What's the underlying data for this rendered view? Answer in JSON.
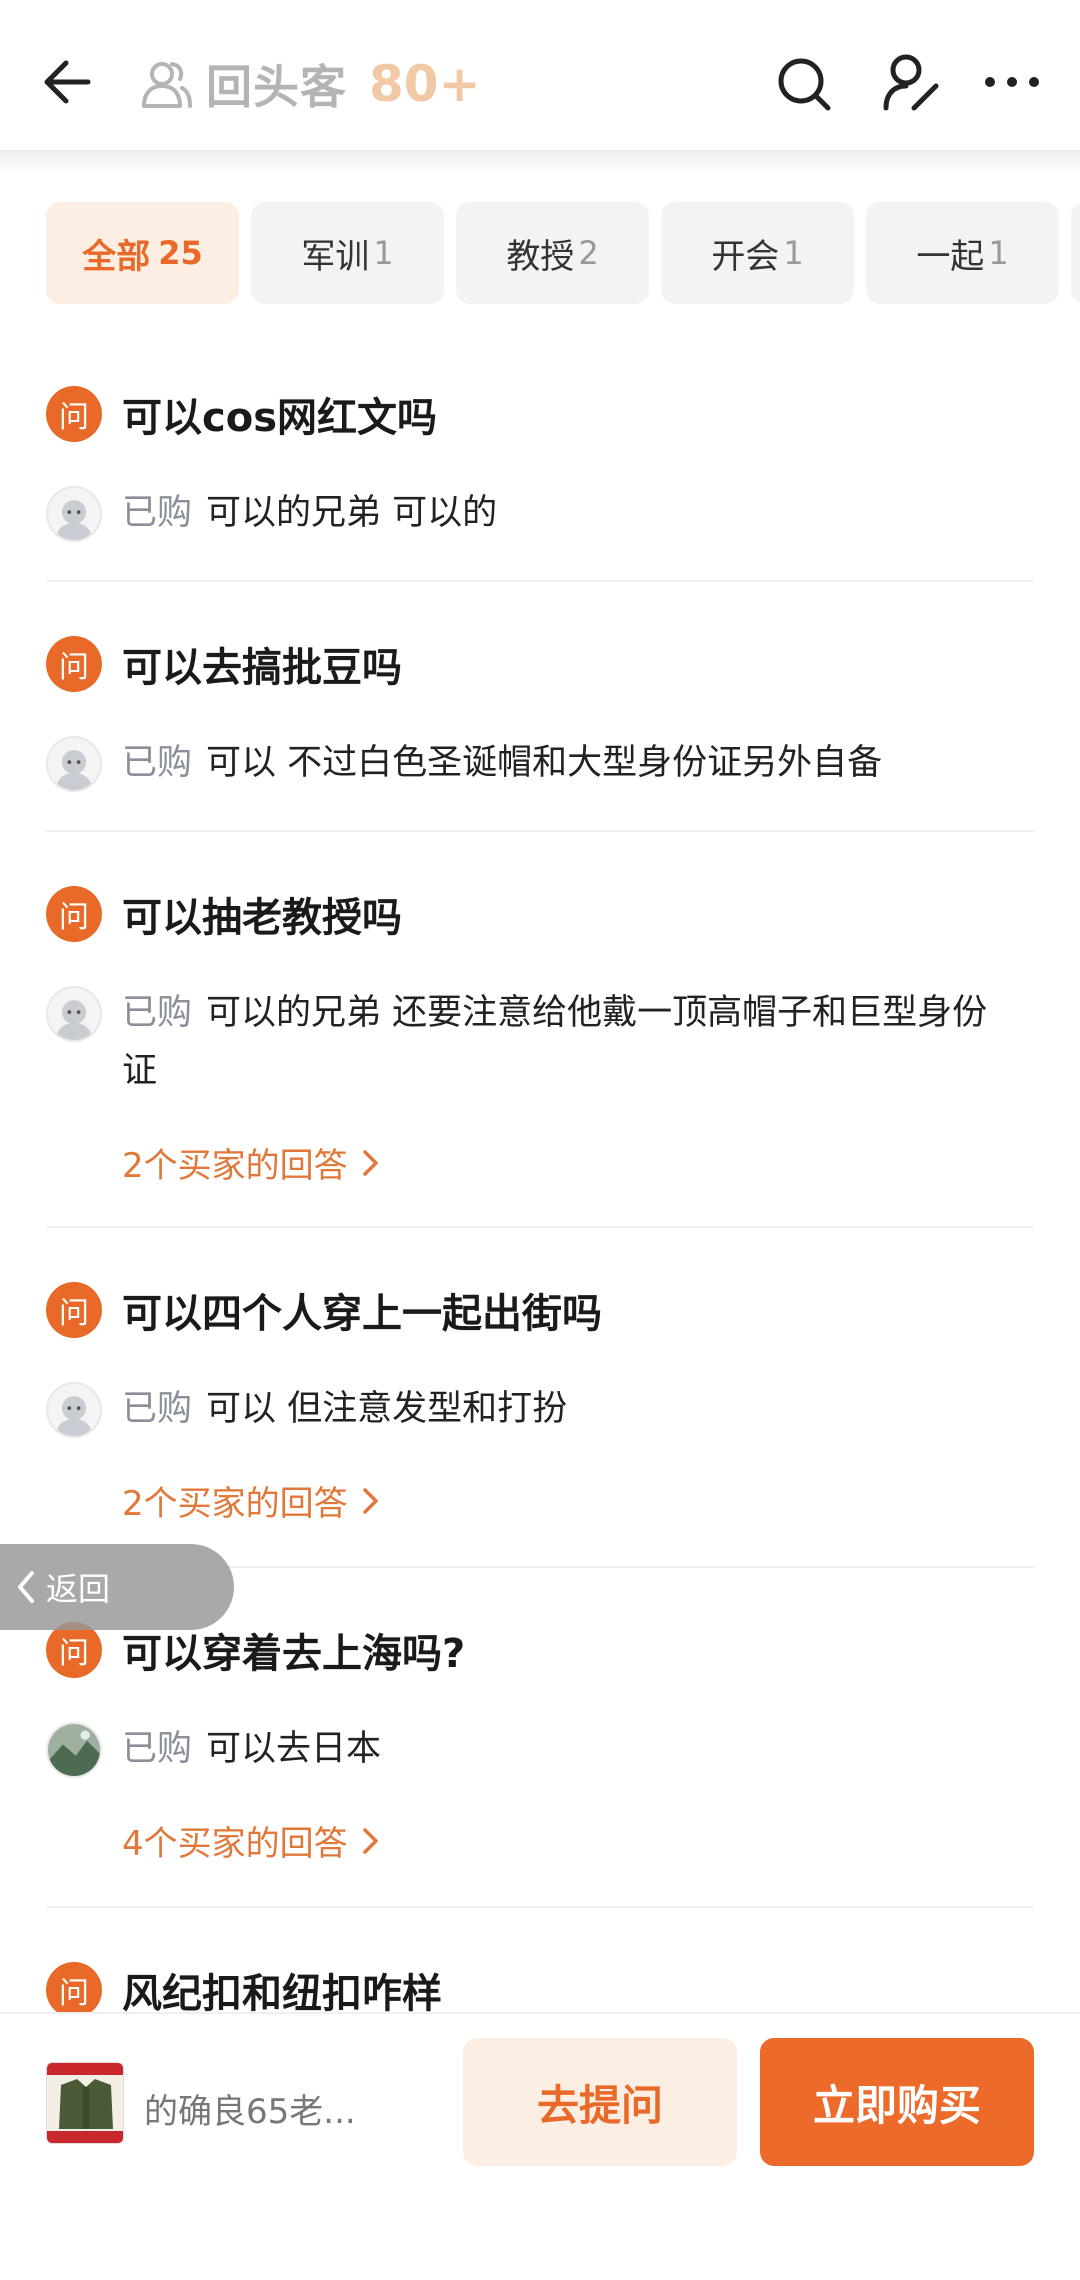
{
  "header": {
    "title": "回头客",
    "count": "80+"
  },
  "tabs": [
    {
      "label": "全部",
      "count": "25"
    },
    {
      "label": "军训",
      "count": "1"
    },
    {
      "label": "教授",
      "count": "2"
    },
    {
      "label": "开会",
      "count": "1"
    },
    {
      "label": "一起",
      "count": "1"
    }
  ],
  "qa_badge": "问",
  "purchased_tag": "已购",
  "questions": [
    {
      "q": "可以cos网红文吗",
      "a": "可以的兄弟 可以的",
      "more": ""
    },
    {
      "q": "可以去搞批豆吗",
      "a": "可以 不过白色圣诞帽和大型身份证另外自备",
      "more": ""
    },
    {
      "q": "可以抽老教授吗",
      "a": "可以的兄弟 还要注意给他戴一顶高帽子和巨型身份证",
      "more": "2个买家的回答"
    },
    {
      "q": "可以四个人穿上一起出街吗",
      "a": "可以 但注意发型和打扮",
      "more": "2个买家的回答"
    },
    {
      "q": "可以穿着去上海吗?",
      "a": "可以去日本",
      "more": "4个买家的回答"
    },
    {
      "q": "风纪扣和纽扣咋样",
      "a": "",
      "more": ""
    }
  ],
  "float_back": {
    "label": "返回"
  },
  "bottom": {
    "product_name": "的确良65老...",
    "ask_label": "去提问",
    "buy_label": "立即购买"
  },
  "colors": {
    "accent": "#e96a28",
    "tab_active_bg": "#fdeee3"
  }
}
